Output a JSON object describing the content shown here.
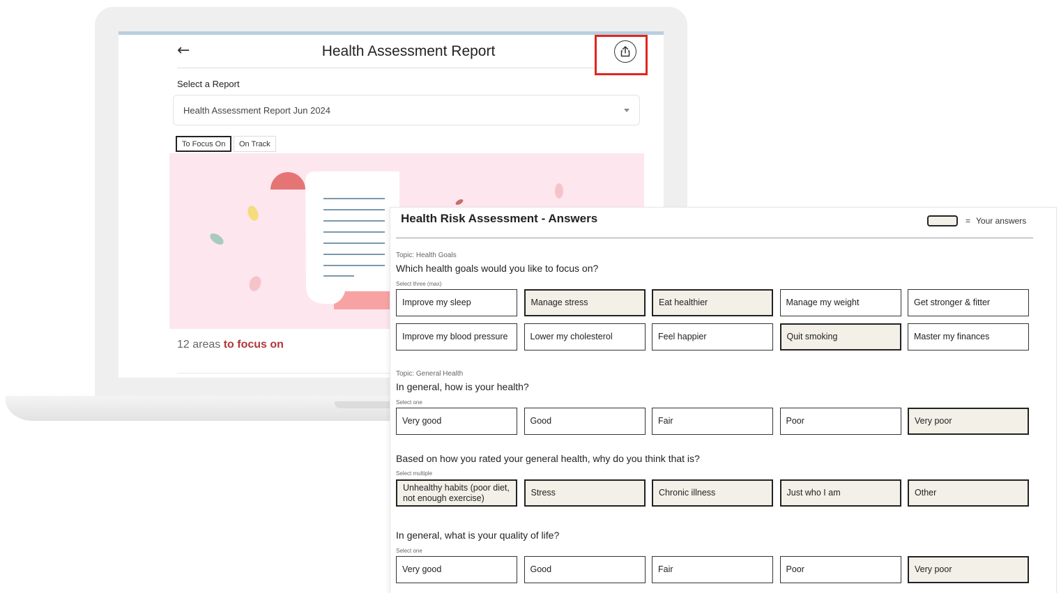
{
  "app": {
    "title": "Health Assessment Report",
    "back_label": "←",
    "select_label": "Select a Report",
    "selected_report": "Health Assessment Report Jun 2024",
    "tabs": [
      {
        "label": "To Focus On",
        "active": true
      },
      {
        "label": "On Track",
        "active": false
      }
    ],
    "areas_count": "12 areas",
    "areas_accent": "to focus on",
    "accent_color": "#b0363a",
    "highlight_color": "#e0261f"
  },
  "answers": {
    "title": "Health Risk Assessment - Answers",
    "legend_eq": "=",
    "legend_label": "Your answers",
    "sections": [
      {
        "topic": "Topic: Health Goals",
        "question": "Which health goals would you like to focus on?",
        "hint": "Select three (max)",
        "options": [
          {
            "label": "Improve my sleep",
            "selected": false
          },
          {
            "label": "Manage stress",
            "selected": true
          },
          {
            "label": "Eat healthier",
            "selected": true
          },
          {
            "label": "Manage my weight",
            "selected": false
          },
          {
            "label": "Get stronger & fitter",
            "selected": false
          },
          {
            "label": "Improve my blood pressure",
            "selected": false
          },
          {
            "label": "Lower my cholesterol",
            "selected": false
          },
          {
            "label": "Feel happier",
            "selected": false
          },
          {
            "label": "Quit smoking",
            "selected": true
          },
          {
            "label": "Master my finances",
            "selected": false
          }
        ]
      },
      {
        "topic": "Topic: General Health",
        "question": "In general, how is your health?",
        "hint": "Select one",
        "options": [
          {
            "label": "Very good",
            "selected": false
          },
          {
            "label": "Good",
            "selected": false
          },
          {
            "label": "Fair",
            "selected": false
          },
          {
            "label": "Poor",
            "selected": false
          },
          {
            "label": "Very poor",
            "selected": true
          }
        ]
      },
      {
        "topic": "",
        "question": "Based on how you rated your general health, why do you think that is?",
        "hint": "Select multiple",
        "options": [
          {
            "label": "Unhealthy habits (poor diet, not enough exercise)",
            "selected": true
          },
          {
            "label": "Stress",
            "selected": true
          },
          {
            "label": "Chronic illness",
            "selected": true
          },
          {
            "label": "Just who I am",
            "selected": true
          },
          {
            "label": "Other",
            "selected": true
          }
        ]
      },
      {
        "topic": "",
        "question": "In general, what is your quality of life?",
        "hint": "Select one",
        "options": [
          {
            "label": "Very good",
            "selected": false
          },
          {
            "label": "Good",
            "selected": false
          },
          {
            "label": "Fair",
            "selected": false
          },
          {
            "label": "Poor",
            "selected": false
          },
          {
            "label": "Very poor",
            "selected": true
          }
        ]
      }
    ]
  }
}
